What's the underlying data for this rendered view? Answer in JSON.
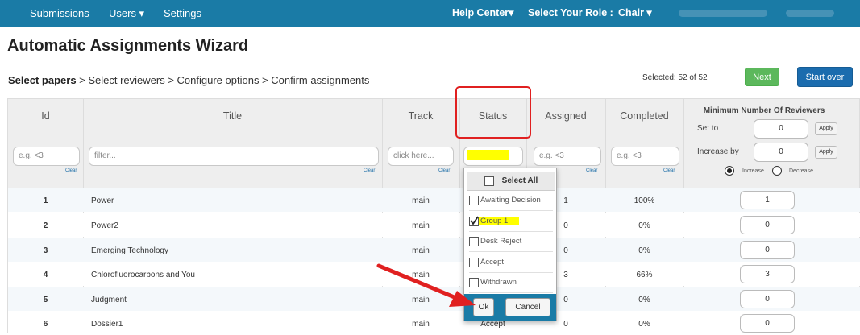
{
  "nav": {
    "submissions": "Submissions",
    "users": "Users ▾",
    "settings": "Settings",
    "help_center": "Help Center▾",
    "select_role_label": "Select Your Role :",
    "role_value": "Chair ▾"
  },
  "page": {
    "title": "Automatic Assignments Wizard",
    "breadcrumb_current": "Select papers",
    "breadcrumb_rest": " > Select reviewers > Configure options > Confirm assignments",
    "selected_text": "Selected: 52 of 52",
    "next_label": "Next",
    "start_over_label": "Start over"
  },
  "table": {
    "headers": {
      "id": "Id",
      "title": "Title",
      "track": "Track",
      "status": "Status",
      "assigned": "Assigned",
      "completed": "Completed"
    },
    "filters": {
      "id_placeholder": "e.g. <3",
      "title_placeholder": "filter...",
      "track_placeholder": "click here...",
      "assigned_placeholder": "e.g. <3",
      "completed_placeholder": "e.g. <3",
      "clear": "Clear"
    },
    "min_reviewers": {
      "title": "Minimum Number Of Reviewers",
      "set_to_label": "Set to",
      "set_to_value": "0",
      "increase_by_label": "Increase by",
      "increase_by_value": "0",
      "apply": "Apply",
      "increase": "Increase",
      "decrease": "Decrease",
      "mode": "Increase"
    },
    "rows": [
      {
        "id": "1",
        "title": "Power",
        "track": "main",
        "status": "",
        "assigned": "1",
        "completed": "100%",
        "min": "1"
      },
      {
        "id": "2",
        "title": "Power2",
        "track": "main",
        "status": "",
        "assigned": "0",
        "completed": "0%",
        "min": "0"
      },
      {
        "id": "3",
        "title": "Emerging Technology",
        "track": "main",
        "status": "",
        "assigned": "0",
        "completed": "0%",
        "min": "0"
      },
      {
        "id": "4",
        "title": "Chlorofluorocarbons and You",
        "track": "main",
        "status": "",
        "assigned": "3",
        "completed": "66%",
        "min": "3"
      },
      {
        "id": "5",
        "title": "Judgment",
        "track": "main",
        "status": "",
        "assigned": "0",
        "completed": "0%",
        "min": "0"
      },
      {
        "id": "6",
        "title": "Dossier1",
        "track": "main",
        "status": "Accept",
        "assigned": "0",
        "completed": "0%",
        "min": "0"
      }
    ]
  },
  "status_dropdown": {
    "select_all": "Select All",
    "options": [
      {
        "label": "Awaiting Decision",
        "checked": false
      },
      {
        "label": "Group 1",
        "checked": true
      },
      {
        "label": "Desk Reject",
        "checked": false
      },
      {
        "label": "Accept",
        "checked": false
      },
      {
        "label": "Withdrawn",
        "checked": false
      }
    ],
    "ok_label": "Ok",
    "cancel_label": "Cancel"
  },
  "colors": {
    "navbar": "#1a7ba6",
    "highlight": "#ffff00",
    "annotation_red": "#e02020"
  }
}
